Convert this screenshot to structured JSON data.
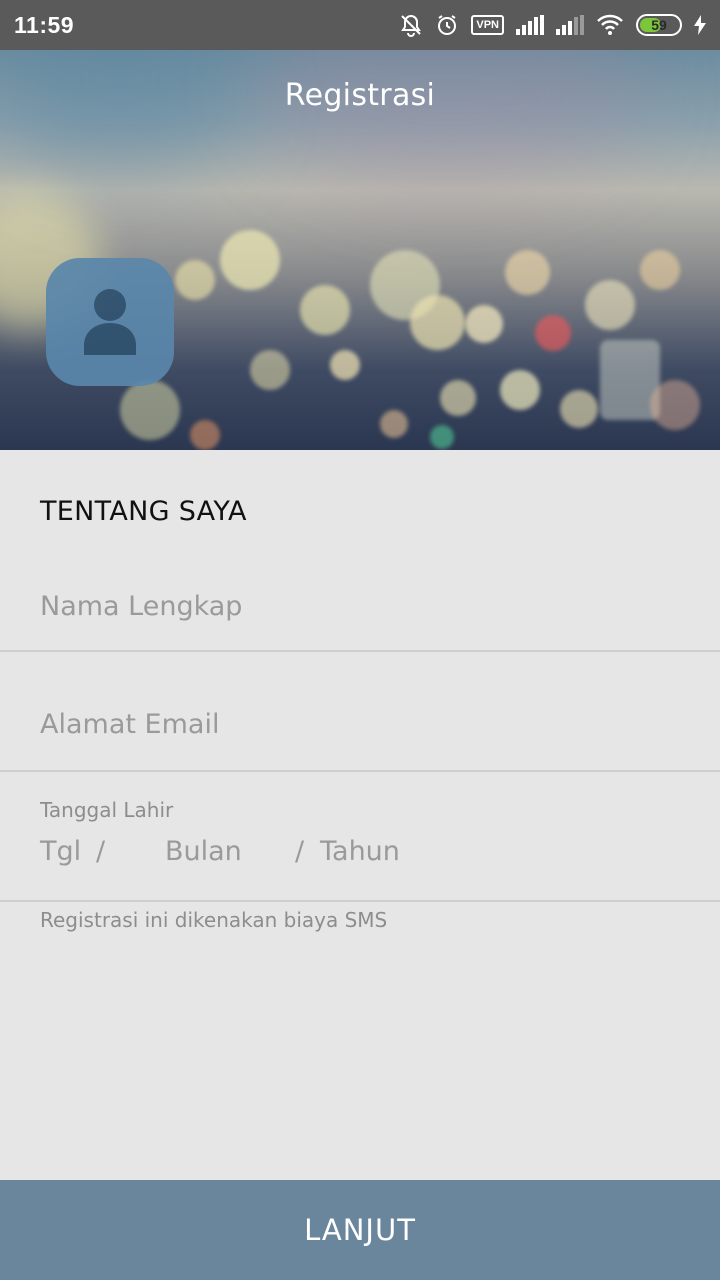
{
  "status_bar": {
    "time": "11:59",
    "vpn": "VPN",
    "battery": "59",
    "battery_level": 0.59,
    "battery_color": "#7cc63a",
    "icons": [
      "notifications-off-icon",
      "alarm-icon",
      "vpn-icon",
      "signal-icon",
      "signal-weak-icon",
      "wifi-icon",
      "battery-icon",
      "charging-icon"
    ]
  },
  "header": {
    "title": "Registrasi",
    "avatar_icon": "user-icon"
  },
  "form": {
    "section_title": "TENTANG SAYA",
    "full_name_placeholder": "Nama Lengkap",
    "email_placeholder": "Alamat Email",
    "dob_label": "Tanggal Lahir",
    "dob_day": "Tgl",
    "dob_sep1": "/",
    "dob_month": "Bulan",
    "dob_sep2": "/",
    "dob_year": "Tahun",
    "sms_note": "Registrasi ini dikenakan biaya SMS"
  },
  "actions": {
    "next_label": "LANJUT"
  },
  "colors": {
    "button": "#6a869c",
    "avatar": "#5a87ab",
    "background": "#e6e6e6"
  }
}
